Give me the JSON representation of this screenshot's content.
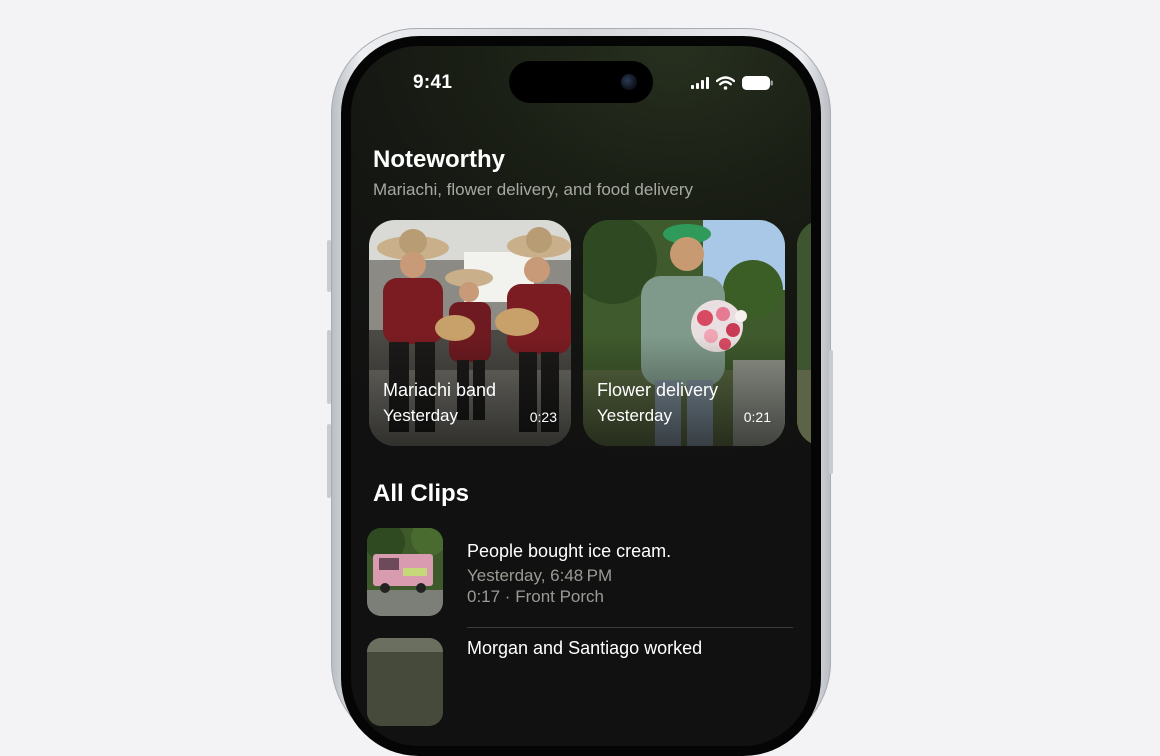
{
  "status_bar": {
    "time": "9:41"
  },
  "noteworthy": {
    "title": "Noteworthy",
    "subtitle": "Mariachi, flower delivery, and food delivery",
    "cards": [
      {
        "title": "Mariachi band",
        "date": "Yesterday",
        "duration": "0:23"
      },
      {
        "title": "Flower delivery",
        "date": "Yesterday",
        "duration": "0:21"
      }
    ]
  },
  "all_clips": {
    "title": "All Clips",
    "items": [
      {
        "title": "People bought ice cream.",
        "date": "Yesterday, 6:48 PM",
        "meta": "0:17 · Front Porch"
      },
      {
        "title": "Morgan and Santiago worked"
      }
    ]
  },
  "icons": [
    "signal-icon",
    "wifi-icon",
    "battery-icon",
    "camera-icon"
  ],
  "colors": {
    "background": "#f3f3f6",
    "screen": "#161813",
    "primary_text": "#ffffff",
    "secondary_text": "#a7a8a3"
  }
}
